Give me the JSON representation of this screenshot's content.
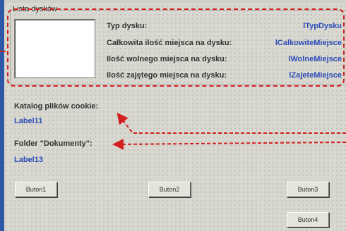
{
  "groupbox": {
    "label": "Lista dysków"
  },
  "disk_info": [
    {
      "label": "Typ dysku:",
      "value": "lTypDysku"
    },
    {
      "label": "Całkowita ilość miejsca na dysku:",
      "value": "lCalkowiteMiejsce"
    },
    {
      "label": "Ilość wolnego miejsca na dysku:",
      "value": "lWolneMiejsce"
    },
    {
      "label": "Ilość zajętego miejsca na dysku:",
      "value": "lZajeteMiejsce"
    }
  ],
  "cookie_section": {
    "label": "Katalog plików cookie:",
    "value": "Label11"
  },
  "documents_section": {
    "label": "Folder \"Dokumenty\":",
    "value": "Label13"
  },
  "buttons": {
    "b1": "Buton1",
    "b2": "Buton2",
    "b3": "Buton3",
    "b4": "Buton4"
  },
  "colors": {
    "annotation": "#d22020",
    "value_text": "#2c4bb8",
    "form_bg": "#d8d8d0"
  }
}
